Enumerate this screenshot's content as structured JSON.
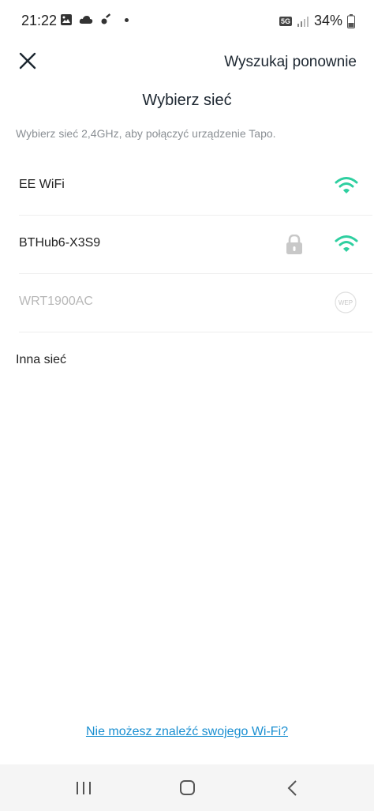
{
  "status_bar": {
    "time": "21:22",
    "network_badge": "5G",
    "battery_percent": "34%",
    "icons": [
      "gallery-icon",
      "cloud-icon",
      "vpn-key-icon",
      "notification-dot-icon",
      "network-5g-icon",
      "signal-icon",
      "battery-icon"
    ]
  },
  "header": {
    "close_icon": "close-icon",
    "rescan_label": "Wyszukaj ponownie",
    "title": "Wybierz sieć",
    "subtitle": "Wybierz sieć 2,4GHz, aby połączyć urządzenie Tapo."
  },
  "networks": [
    {
      "name": "EE WiFi",
      "secured": false,
      "signal_icon": "wifi-strong-icon",
      "enabled": true
    },
    {
      "name": "BTHub6-X3S9",
      "secured": true,
      "signal_icon": "wifi-strong-icon",
      "enabled": true
    },
    {
      "name": "WRT1900AC",
      "secured": false,
      "signal_icon": "wep-icon",
      "badge": "WEP",
      "enabled": false
    }
  ],
  "other_network_label": "Inna sieć",
  "help_link": "Nie możesz znaleźć swojego Wi-Fi?",
  "colors": {
    "accent_wifi": "#2ecfa0",
    "link": "#1a8fd1",
    "disabled": "#b8b8b8"
  },
  "nav_bar": {
    "icons": [
      "recent-apps-icon",
      "home-icon",
      "back-icon"
    ]
  }
}
